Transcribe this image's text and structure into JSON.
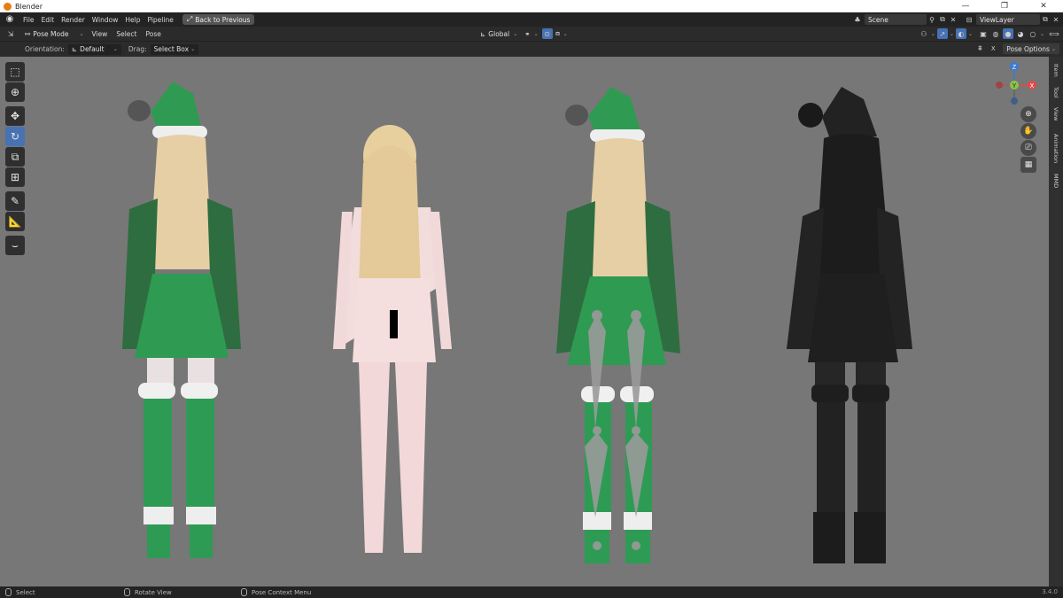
{
  "window": {
    "title": "Blender",
    "min_icon": "minimize-icon",
    "max_icon": "maximize-icon",
    "close_icon": "close-icon"
  },
  "menubar": {
    "items": [
      "File",
      "Edit",
      "Render",
      "Window",
      "Help",
      "Pipeline"
    ],
    "back_button": "Back to Previous",
    "scene": "Scene",
    "view_layer": "ViewLayer"
  },
  "header": {
    "mode": "Pose Mode",
    "menus": [
      "View",
      "Select",
      "Pose"
    ],
    "transform_orientation": "Global"
  },
  "tool_settings": {
    "orientation_label": "Orientation:",
    "orientation_value": "Default",
    "drag_label": "Drag:",
    "drag_value": "Select Box",
    "pose_options": "Pose Options"
  },
  "sidebar_tabs": [
    "Item",
    "Tool",
    "View",
    "Animation",
    "MMD"
  ],
  "gizmo": {
    "z": "Z",
    "y": "Y",
    "x": "X"
  },
  "status": {
    "select": "Select",
    "rotate": "Rotate View",
    "context": "Pose Context Menu",
    "version": "3.4.0"
  },
  "colors": {
    "viewport_bg": "#777777",
    "active_blue": "#4772b3",
    "costume_green": "#2f9a52"
  }
}
